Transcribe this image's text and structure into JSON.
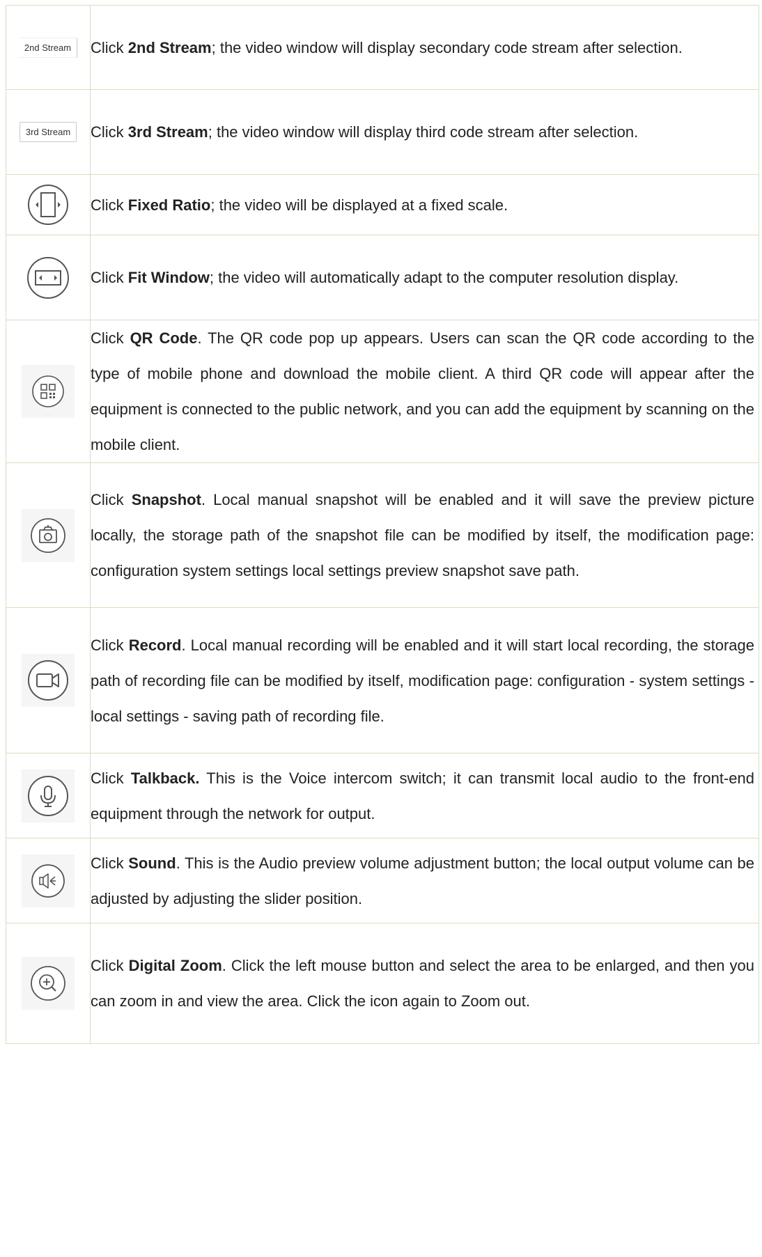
{
  "rows": [
    {
      "icon": "2nd-stream-button",
      "button_label": "2nd Stream",
      "pre": "Click ",
      "bold": "2nd Stream",
      "post": "; the video window will display secondary code stream after selection."
    },
    {
      "icon": "3rd-stream-button",
      "button_label": "3rd Stream",
      "pre": "Click ",
      "bold": "3rd Stream",
      "post": "; the video window will display third code stream after selection."
    },
    {
      "icon": "fixed-ratio-icon",
      "pre": "Click ",
      "bold": "Fixed Ratio",
      "post": "; the video will be displayed at a fixed scale."
    },
    {
      "icon": "fit-window-icon",
      "pre": "Click ",
      "bold": "Fit Window",
      "post": "; the video will automatically adapt to the computer resolution display."
    },
    {
      "icon": "qr-code-icon",
      "pre": "Click ",
      "bold": "QR Code",
      "post": ". The QR code pop up appears. Users can scan the QR code according to the type of mobile phone and download the mobile client. A third QR code will appear after the equipment is connected to the public network, and you can add the equipment by scanning on the mobile client."
    },
    {
      "icon": "snapshot-camera-icon",
      "pre": "Click ",
      "bold": "Snapshot",
      "post": ". Local manual snapshot will be enabled and it will save the preview picture locally, the storage path of the snapshot file can be modified by itself, the modification page: configuration system settings local settings preview snapshot save path."
    },
    {
      "icon": "record-video-icon",
      "pre": "Click ",
      "bold": "Record",
      "post": ". Local manual recording will be enabled and it will start local recording, the storage path of recording file can be modified by itself, modification page: configuration - system settings - local settings - saving path of recording file."
    },
    {
      "icon": "microphone-icon",
      "pre": "Click ",
      "bold": "Talkback.",
      "post": " This is the Voice intercom switch; it can transmit local audio to the front-end equipment through the network for output."
    },
    {
      "icon": "speaker-icon",
      "pre": "Click ",
      "bold": "Sound",
      "post": ". This is the Audio preview volume adjustment button; the local output volume can be adjusted by adjusting the slider position."
    },
    {
      "icon": "zoom-in-icon",
      "pre": "Click ",
      "bold": "Digital Zoom",
      "post": ". Click the left mouse button and select the area to be enlarged, and then you can zoom in and view the area. Click the icon again to Zoom out."
    }
  ],
  "colors": {
    "border": "#dcdcbd",
    "icon_stroke": "#555555",
    "icon_bg": "#f5f5f5"
  }
}
